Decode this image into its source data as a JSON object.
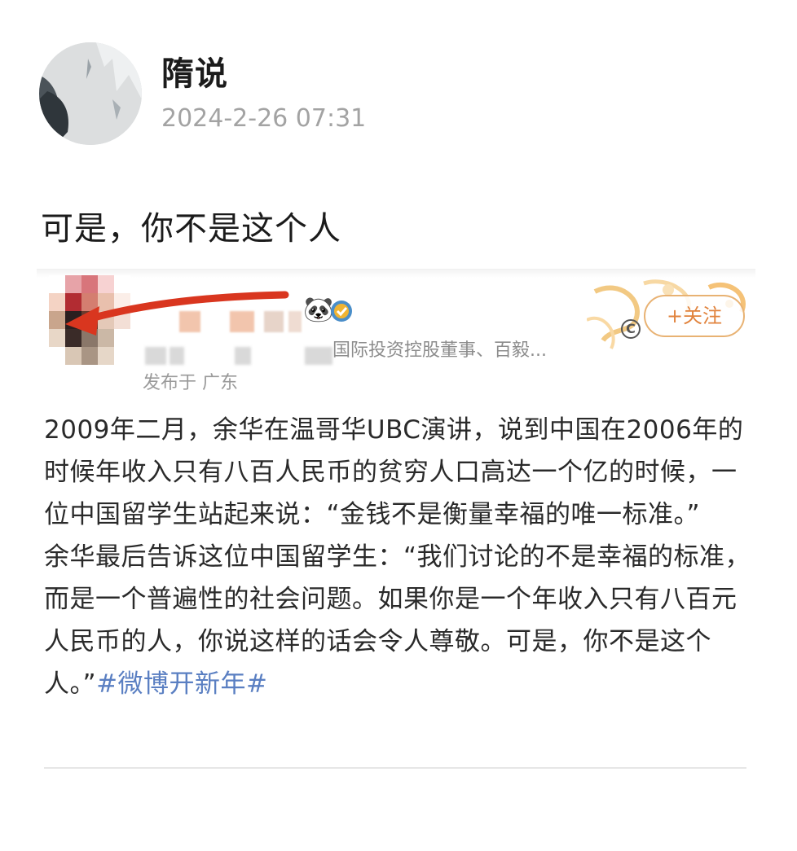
{
  "post": {
    "author": "隋说",
    "timestamp": "2024-2-26 07:31",
    "text": "可是，你不是这个人"
  },
  "quoted": {
    "description": "国际投资控股董事、百毅...",
    "location": "发布于 广东",
    "follow_label": "+关注",
    "body_line_1": "2009年二月，余华在温哥华UBC演讲，说到中国在2006年的时候年收入只有八百人民币的贫穷人口高达一个亿的时候，一位中国留学生站起来说：“金钱不是衡量幸福的唯一标准。”",
    "body_line_2": "余华最后告诉这位中国留学生：“我们讨论的不是幸福的标准，而是一个普遍性的社会问题。如果你是一个年收入只有八百元人民币的人，你说这样的话会令人尊敬。可是，你不是这个人。”",
    "hashtag": "#微博开新年#"
  },
  "colors": {
    "hashtag": "#5a7fc2",
    "follow_accent": "#e1833d",
    "arrow": "#d9361f"
  }
}
